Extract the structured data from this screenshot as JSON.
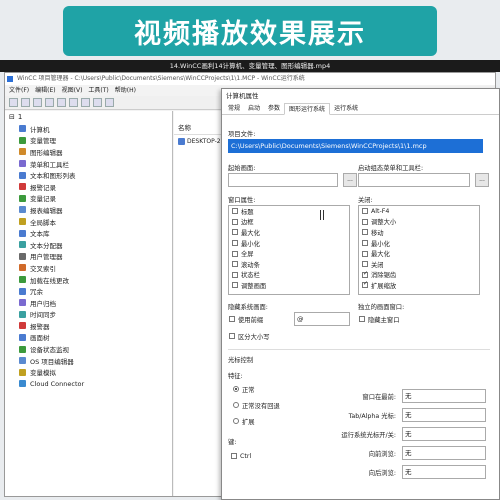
{
  "banner": {
    "title": "视频播放效果展示"
  },
  "video": {
    "title": "14.WinCC画利14计算机、变量管理、图形编辑器.mp4"
  },
  "app": {
    "title": "WinCC 项目管理器 - C:\\Users\\Public\\Documents\\Siemens\\WinCCProjects\\1\\1.MCP - WinCC运行系统",
    "menu": [
      "文件(F)",
      "编辑(E)",
      "视图(V)",
      "工具(T)",
      "帮助(H)"
    ]
  },
  "tree": {
    "root": "1",
    "items": [
      {
        "label": "计算机",
        "color": "#4a7bd0"
      },
      {
        "label": "变量管理",
        "color": "#3c9a3c"
      },
      {
        "label": "图形编辑器",
        "color": "#d08a2a"
      },
      {
        "label": "菜单和工具栏",
        "color": "#7a6ad0"
      },
      {
        "label": "文本和图形列表",
        "color": "#4a7bd0"
      },
      {
        "label": "报警记录",
        "color": "#d03a3a"
      },
      {
        "label": "变量记录",
        "color": "#3c9a3c"
      },
      {
        "label": "报表编辑器",
        "color": "#5a8ad0"
      },
      {
        "label": "全局脚本",
        "color": "#c0a020"
      },
      {
        "label": "文本库",
        "color": "#4a7bd0"
      },
      {
        "label": "文本分配器",
        "color": "#3aa0a0"
      },
      {
        "label": "用户管理器",
        "color": "#6a6a6a"
      },
      {
        "label": "交叉索引",
        "color": "#d06a2a"
      },
      {
        "label": "加载在线更改",
        "color": "#3c9a3c"
      },
      {
        "label": "冗余",
        "color": "#4a7bd0"
      },
      {
        "label": "用户归档",
        "color": "#7a6ad0"
      },
      {
        "label": "时间同步",
        "color": "#3aa0a0"
      },
      {
        "label": "报警器",
        "color": "#d03a3a"
      },
      {
        "label": "画面树",
        "color": "#4a7bd0"
      },
      {
        "label": "设备状态监视",
        "color": "#3c9a3c"
      },
      {
        "label": "OS 项目编辑器",
        "color": "#5a8ad0"
      },
      {
        "label": "变量模拟",
        "color": "#c0a020"
      },
      {
        "label": "Cloud Connector",
        "color": "#3a8ad0"
      }
    ]
  },
  "mid": {
    "header": "名称",
    "row": "DESKTOP-2"
  },
  "dialog": {
    "title": "计算机属性",
    "tabs": [
      "常规",
      "启动",
      "参数",
      "图形运行系统",
      "运行系统"
    ],
    "active_tab": 3,
    "project_file_label": "项目文件:",
    "project_file_value": "C:\\Users\\Public\\Documents\\Siemens\\WinCCProjects\\1\\1.mcp",
    "start_screen_label": "起始画面:",
    "start_menu_label": "启动组态菜单和工具栏:",
    "browse": "...",
    "window_attr_label": "窗口属性:",
    "window_attrs": [
      {
        "label": "标题",
        "checked": false
      },
      {
        "label": "边框",
        "checked": false
      },
      {
        "label": "最大化",
        "checked": false
      },
      {
        "label": "最小化",
        "checked": false
      },
      {
        "label": "全屏",
        "checked": false
      },
      {
        "label": "滚动条",
        "checked": false
      },
      {
        "label": "状态栏",
        "checked": false
      },
      {
        "label": "调整画面",
        "checked": false
      }
    ],
    "disable_label": "关闭:",
    "disable_keys": [
      {
        "label": "Alt-F4",
        "checked": false
      },
      {
        "label": "调整大小",
        "checked": false
      },
      {
        "label": "移动",
        "checked": false
      },
      {
        "label": "最小化",
        "checked": false
      },
      {
        "label": "最大化",
        "checked": false
      },
      {
        "label": "关闭",
        "checked": false
      },
      {
        "label": "消除锯齿",
        "checked": true
      },
      {
        "label": "扩展缩放",
        "checked": true
      }
    ],
    "hide_system_label": "隐藏系统画面:",
    "use_prefix_label": "使用前缀",
    "prefix_value": "@",
    "case_label": "区分大小写",
    "standalone_label": "独立的画面窗口:",
    "hide_main_label": "隐藏主窗口",
    "cursor_control_label": "光标控制",
    "feature_label": "特征:",
    "features": [
      {
        "label": "正常",
        "selected": true
      },
      {
        "label": "正常没有回退",
        "selected": false
      },
      {
        "label": "扩展",
        "selected": false
      }
    ],
    "keys_label": "键:",
    "ctrl_label": "Ctrl",
    "right_fields": [
      {
        "label": "窗口在最前:",
        "value": "无"
      },
      {
        "label": "Tab/Alpha 光标:",
        "value": "无"
      },
      {
        "label": "运行系统光标开/关:",
        "value": "无"
      },
      {
        "label": "向前浏览:",
        "value": "无"
      },
      {
        "label": "向后浏览:",
        "value": "无"
      }
    ]
  }
}
